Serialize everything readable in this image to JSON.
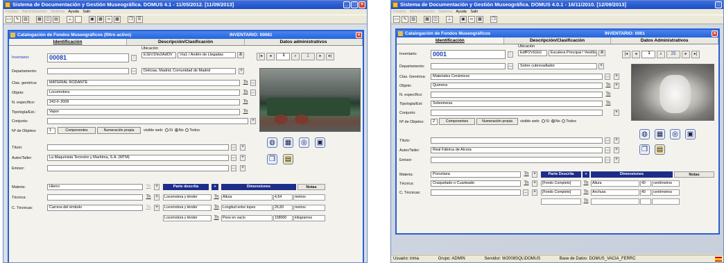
{
  "colors": {
    "titlebar": "#1a4cc4",
    "subwindow": "#2563d9",
    "header_dark": "#1c2d8a",
    "field_blue": "#1c3fb8",
    "close": "#d8452c"
  },
  "s1": {
    "title": "Sistema de Documentación y Gestión Museográfica.    DOMUS 4.1 - 11/05/2012.     [11/09/2013]",
    "menu": {
      "disabled": [
        "Fondos",
        "Administración",
        "Sistema"
      ],
      "enabled": [
        "Ayuda",
        "Salir"
      ]
    },
    "window": {
      "title": "Catalogación de Fondos Museográficos (filtro activo)",
      "inventory": "INVENTARIO: 00081"
    },
    "tabs": [
      "Identificación",
      "Descripción/Clasificación",
      "Datos administrativos"
    ],
    "labels": {
      "inventario": "Inventario:",
      "ubicacion": "Ubicación",
      "departamento": "Departamento:",
      "clas": "Clas. genérica:",
      "objeto": "Objeto:",
      "nesp": "N. específico:",
      "tipologia": "Tipología/Est.:",
      "conjunto": "Conjunto:",
      "nobjetos": "Nº de Objetos:",
      "titulo": "Título:",
      "autor": "Autor/Taller:",
      "emisor": "Emisor:",
      "materia": "Materia:",
      "tecnica": "Técnica:",
      "ctecnicas": "C. Técnicas:"
    },
    "values": {
      "inventario": "00081",
      "ubic_code": "E1EV1Nv2AdOV",
      "ubic_text": "Vía1 / Andén de Llegadas",
      "ubic_place": "Delicias, Madrid, Comunidad de Madrid",
      "clas": "MATERIAL RODANTE",
      "objeto": "Locomotora",
      "nesp": "242-F-2009",
      "tipologia": "Vapor",
      "nobjetos": "1",
      "autor": "La Maquinista Terrestre y Marítima, S.A. (MTM)",
      "materia": "Hierro",
      "ctecnicas": "Carrera del émbolo",
      "nav_record": "1",
      "nav_total": "1"
    },
    "buttons": {
      "componentes": "Componentes",
      "numeracion": "Numeración propia",
      "visible": "visible web:",
      "si": "Sí",
      "no": "No",
      "todos": "Todos",
      "th": "Th"
    },
    "table": {
      "h_parte": "Parte descrita",
      "h_dim": "Dimensiones",
      "h_notas": "Notas",
      "rows": [
        {
          "parte": "Locomotora y ténder",
          "dim": "Altura",
          "val": "4,64",
          "unit": "metros"
        },
        {
          "parte": "Locomotora y ténder",
          "dim": "Longitud entre topes",
          "val": "26,83",
          "unit": "metros"
        },
        {
          "parte": "Locomotora y ténder",
          "dim": "Peso en vacío",
          "val": "158000",
          "unit": "kilogramos"
        }
      ]
    }
  },
  "s2": {
    "title": "Sistema de Documentación y Gestión Museográfica.     DOMUS 4.0.1 - 16/11/2010.      [12/09/2013]",
    "menu": {
      "disabled": [
        "Fondos",
        "Administración",
        "Sistema"
      ],
      "enabled": [
        "Ayuda",
        "Salir"
      ]
    },
    "window": {
      "title": "Catalogación de Fondos Museográficos",
      "inventory": "INVENTARIO: 0001"
    },
    "tabs": [
      "Identificación",
      "Descripción/Clasificación",
      "Datos Administrativos"
    ],
    "labels": {
      "inventario": "Inventario:",
      "ubicacion": "Ubicación",
      "departamento": "Departamento:",
      "clas": "Clas. Genérica:",
      "objeto": "Objeto:",
      "nesp": "N. específico:",
      "tipologia": "Tipología/Est:",
      "conjunto": "Conjunto:",
      "nobjetos": "Nº de Objetos:",
      "titulo": "Título:",
      "autor": "Autor/Taller:",
      "emisor": "Emisor:",
      "materia": "Materia:",
      "tecnica": "Técnica:",
      "ctecnicas": "C. Técnicas:"
    },
    "values": {
      "inventario": "0001",
      "ubic_code": "EdfP2Vt1Et1",
      "ubic_text": "Escalera Principal / Vestíbu",
      "ubic_sub": "Sobre cubreradiador",
      "clas": "Materiales Cerámicos",
      "objeto": "Quimera",
      "tipologia": "Sobremesa",
      "nobjetos": "2",
      "autor": "Real Fábrica de Alcora",
      "materia": "Porcelana",
      "tecnica": "Craquelado o Cuarteado",
      "nav_record": "1",
      "nav_total": "25"
    },
    "buttons": {
      "componentes": "Componentes",
      "numeracion": "Numeración propia",
      "visible": "visible web:",
      "si": "Sí",
      "no": "No",
      "todos": "Todos",
      "th": "Th"
    },
    "table": {
      "h_parte": "Parte Descrita",
      "h_dim": "Dimensiones",
      "h_notas": "Notas",
      "rows": [
        {
          "parte": "[Fondo Completo]",
          "dim": "Altura",
          "val": "40",
          "unit": "centímetros"
        },
        {
          "parte": "[Fondo Completo]",
          "dim": "Anchura",
          "val": "40",
          "unit": "centímetros"
        }
      ]
    },
    "status": {
      "usuario": "Usuario: inma",
      "grupo": "Grupo: ADMIN",
      "servidor": "Servidor: W2008SQL\\DOMUS",
      "base": "Base de Datos: DOMUS_VACIA_FERRC"
    }
  }
}
